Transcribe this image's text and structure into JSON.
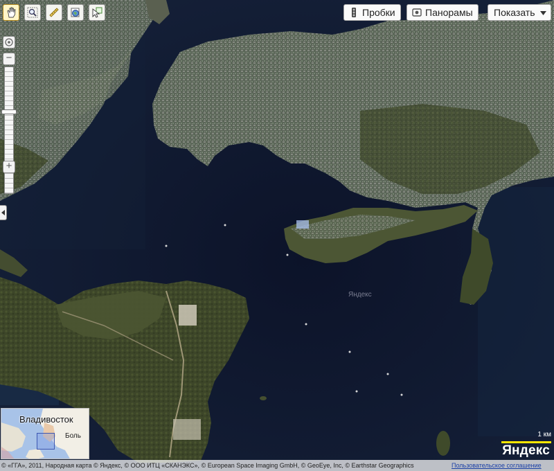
{
  "toolbar": {
    "tools": [
      "hand-tool",
      "magnifier-tool",
      "ruler-tool",
      "globe-info-tool",
      "cursor-info-tool"
    ]
  },
  "top_buttons": {
    "traffic_label": "Пробки",
    "panoramas_label": "Панорамы",
    "show_label": "Показать"
  },
  "zoom": {
    "level_fraction": 0.65
  },
  "watermark": "Яндекс",
  "minimap": {
    "city_label": "Владивосток",
    "partial_label": "Боль"
  },
  "scale": {
    "label": "1 км"
  },
  "logo": "Яндекс",
  "copyright": {
    "text": "© «ГГА», 2011, Народная карта © Яндекс, © ООО ИТЦ «СКАНЭКС», © European Space Imaging GmbH, © GeoEye, Inc, © Earthstar Geographics",
    "agreement_link": "Пользовательское соглашение"
  },
  "colors": {
    "sea": "#0f172e",
    "land": "#414a2c",
    "city": "#6a7064",
    "scale_bar": "#ffe600",
    "link": "#1a3fa6"
  }
}
